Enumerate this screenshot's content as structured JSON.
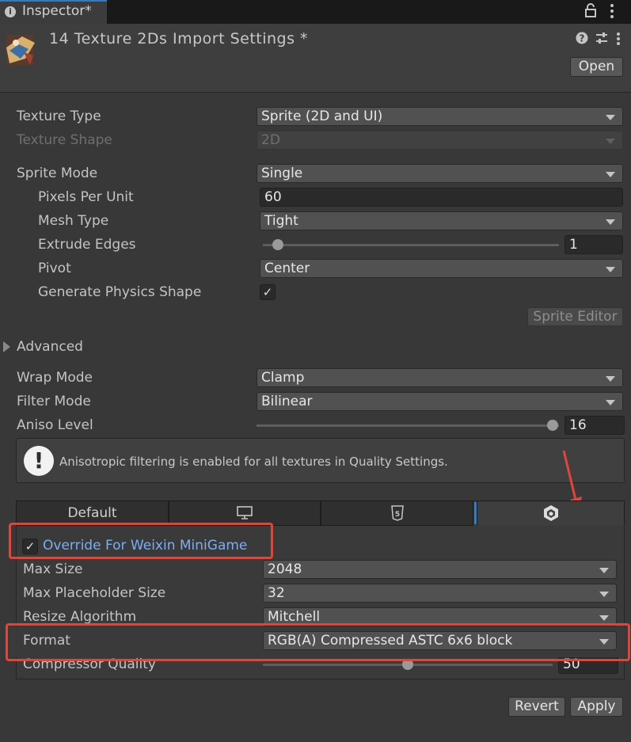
{
  "tab": {
    "title": "Inspector*"
  },
  "header": {
    "title": "14 Texture 2Ds Import Settings *",
    "open_label": "Open"
  },
  "fields": {
    "texture_type": {
      "label": "Texture Type",
      "value": "Sprite (2D and UI)"
    },
    "texture_shape": {
      "label": "Texture Shape",
      "value": "2D"
    },
    "sprite_mode": {
      "label": "Sprite Mode",
      "value": "Single"
    },
    "pixels_per_unit": {
      "label": "Pixels Per Unit",
      "value": "60"
    },
    "mesh_type": {
      "label": "Mesh Type",
      "value": "Tight"
    },
    "extrude_edges": {
      "label": "Extrude Edges",
      "value": "1",
      "slider_fraction": 0.03
    },
    "pivot": {
      "label": "Pivot",
      "value": "Center"
    },
    "generate_physics_shape": {
      "label": "Generate Physics Shape",
      "checked": true
    },
    "sprite_editor_label": "Sprite Editor",
    "advanced_label": "Advanced",
    "wrap_mode": {
      "label": "Wrap Mode",
      "value": "Clamp"
    },
    "filter_mode": {
      "label": "Filter Mode",
      "value": "Bilinear"
    },
    "aniso_level": {
      "label": "Aniso Level",
      "value": "16",
      "slider_fraction": 1.0
    }
  },
  "help": {
    "text": "Anisotropic filtering is enabled for all textures in Quality Settings."
  },
  "platform_tabs": {
    "default_label": "Default",
    "icons": [
      "monitor-icon",
      "html5-icon",
      "minigame-cube-icon"
    ],
    "html5_text": "5"
  },
  "platform": {
    "override_label": "Override For Weixin MiniGame",
    "override_checked": true,
    "max_size": {
      "label": "Max Size",
      "value": "2048"
    },
    "max_placeholder_size": {
      "label": "Max Placeholder Size",
      "value": "32"
    },
    "resize_algorithm": {
      "label": "Resize Algorithm",
      "value": "Mitchell"
    },
    "format": {
      "label": "Format",
      "value": "RGB(A) Compressed ASTC 6x6 block"
    },
    "compressor_quality": {
      "label": "Compressor Quality",
      "value": "50",
      "slider_fraction": 0.5
    }
  },
  "footer": {
    "revert_label": "Revert",
    "apply_label": "Apply"
  },
  "colors": {
    "highlight_red": "#e0453b",
    "link_blue": "#7aaef5",
    "accent_tab": "#3a79bb"
  }
}
